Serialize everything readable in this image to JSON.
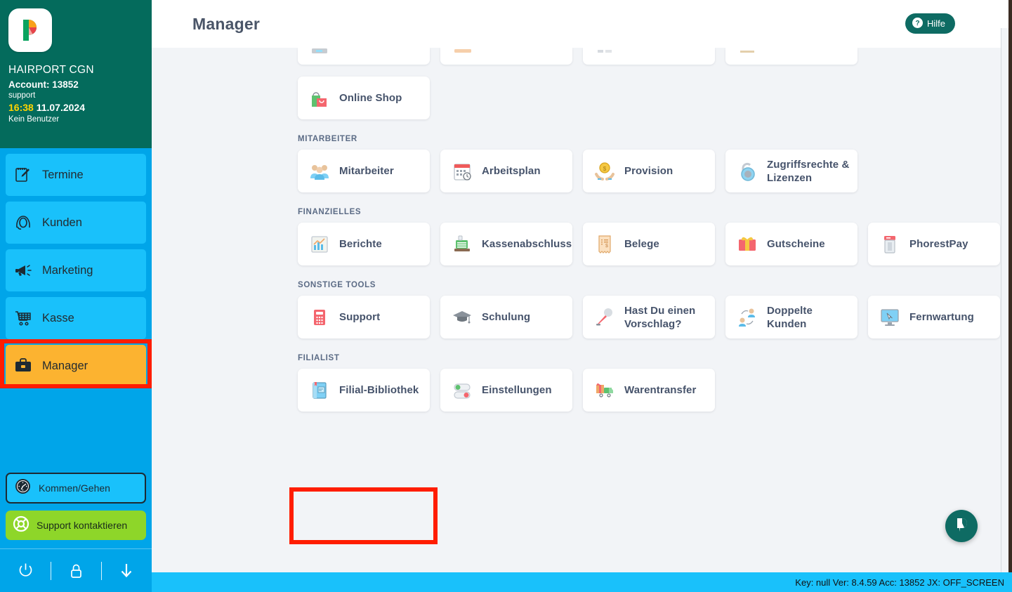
{
  "colors": {
    "sidebar_teal": "#046b5c",
    "sidebar_cyan": "#00a5e9",
    "nav_item": "#19c1fb",
    "nav_active": "#fcb330",
    "highlight_red": "#ff1d00",
    "support_green": "#8ed629",
    "accent_teal": "#0e6b63",
    "card_text": "#46536b",
    "time_yellow": "#ffd400",
    "main_bg": "#f2f4f7"
  },
  "sidebar": {
    "logo_icon": "phorest-logo-icon",
    "salon_name": "HAIRPORT CGN",
    "account_label": "Account: 13852",
    "username": "support",
    "time": "16:38",
    "date": "11.07.2024",
    "no_user": "Kein Benutzer",
    "nav_items": [
      {
        "label": "Termine",
        "icon": "calendar-pen-icon",
        "active": false
      },
      {
        "label": "Kunden",
        "icon": "client-head-icon",
        "active": false
      },
      {
        "label": "Marketing",
        "icon": "megaphone-icon",
        "active": false
      },
      {
        "label": "Kasse",
        "icon": "shopping-cart-icon",
        "active": false
      },
      {
        "label": "Manager",
        "icon": "briefcase-icon",
        "active": true
      }
    ],
    "clock_button": {
      "label": "Kommen/Gehen",
      "icon": "clock-icon"
    },
    "support_button": {
      "label": "Support kontaktieren",
      "icon": "lifebuoy-icon"
    },
    "bottom_icons": [
      {
        "name": "power-icon"
      },
      {
        "name": "lock-icon"
      },
      {
        "name": "download-arrow-icon"
      }
    ]
  },
  "header": {
    "title": "Manager",
    "help_button": {
      "label": "Hilfe",
      "icon": "question-circle-icon"
    }
  },
  "main": {
    "cut_off_row": [
      {
        "icon": "keyboard-icon"
      },
      {
        "icon": "ruler-icon"
      },
      {
        "icon": "tag-icon"
      },
      {
        "icon": "euro-icon"
      }
    ],
    "top_partial_section": {
      "cards": [
        {
          "label": "Online Shop",
          "icon": "shopping-bag-icon"
        }
      ]
    },
    "sections": [
      {
        "label": "MITARBEITER",
        "cards": [
          {
            "label": "Mitarbeiter",
            "icon": "staff-group-icon"
          },
          {
            "label": "Arbeitsplan",
            "icon": "calendar-clock-icon"
          },
          {
            "label": "Provision",
            "icon": "coin-hands-icon"
          },
          {
            "label": "Zugriffsrechte & Lizenzen",
            "icon": "padlock-icon"
          }
        ]
      },
      {
        "label": "FINANZIELLES",
        "cards": [
          {
            "label": "Berichte",
            "icon": "chart-report-icon"
          },
          {
            "label": "Kassenabschluss",
            "icon": "cash-register-icon"
          },
          {
            "label": "Belege",
            "icon": "receipt-icon"
          },
          {
            "label": "Gutscheine",
            "icon": "gift-voucher-icon"
          },
          {
            "label": "PhorestPay",
            "icon": "card-terminal-icon"
          }
        ]
      },
      {
        "label": "SONSTIGE TOOLS",
        "cards": [
          {
            "label": "Support",
            "icon": "telephone-icon"
          },
          {
            "label": "Schulung",
            "icon": "graduation-cap-icon"
          },
          {
            "label": "Hast Du einen Vorschlag?",
            "icon": "microphone-icon"
          },
          {
            "label": "Doppelte Kunden",
            "icon": "duplicate-clients-icon"
          },
          {
            "label": "Fernwartung",
            "icon": "remote-desktop-icon"
          }
        ]
      },
      {
        "label": "FILIALIST",
        "cards": [
          {
            "label": "Filial-Bibliothek",
            "icon": "book-icon"
          },
          {
            "label": "Einstellungen",
            "icon": "toggle-switches-icon"
          },
          {
            "label": "Warentransfer",
            "icon": "delivery-truck-icon"
          }
        ]
      }
    ]
  },
  "chat_bubble": {
    "icon": "phorest-chat-icon"
  },
  "footer": {
    "status_text": "Key: null Ver: 8.4.59 Acc: 13852  JX: OFF_SCREEN"
  }
}
